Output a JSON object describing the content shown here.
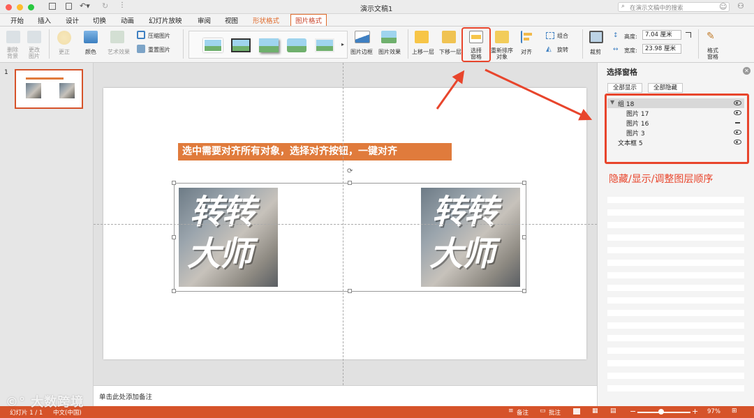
{
  "window": {
    "title": "演示文稿1"
  },
  "search": {
    "placeholder": "在演示文稿中的搜索"
  },
  "ribbon_tabs": [
    "开始",
    "插入",
    "设计",
    "切换",
    "动画",
    "幻灯片放映",
    "审阅",
    "视图",
    "形状格式",
    "图片格式"
  ],
  "ribbon": {
    "remove_bg": "删除\n背景",
    "change_pic": "更改\n图片",
    "corrections": "更正",
    "color": "颜色",
    "artistic": "艺术效果",
    "compress": "压缩图片",
    "reset": "重置图片",
    "pic_border": "图片边框",
    "pic_effects": "图片效果",
    "bring_forward": "上移一层",
    "send_backward": "下移一层",
    "selection_pane": "选择\n窗格",
    "reorder": "重新排序\n对象",
    "align": "对齐",
    "group": "组合",
    "rotate": "旋转",
    "crop": "裁剪",
    "height_label": "高度:",
    "height_value": "7.04 厘米",
    "width_label": "宽度:",
    "width_value": "23.98 厘米",
    "format_pane": "格式\n窗格"
  },
  "thumbnail": {
    "number": "1"
  },
  "slide": {
    "banner": "选中需要对齐所有对象，选择对齐按钮，一键对齐",
    "image_text_line1": "转转",
    "image_text_line2": "大师"
  },
  "notes": {
    "placeholder": "单击此处添加备注"
  },
  "selection_pane": {
    "title": "选择窗格",
    "show_all": "全部显示",
    "hide_all": "全部隐藏",
    "items": [
      {
        "label": "组 18",
        "visible": true
      },
      {
        "label": "图片 17",
        "visible": true
      },
      {
        "label": "图片 16",
        "visible": false
      },
      {
        "label": "图片 3",
        "visible": true
      },
      {
        "label": "文本框 5",
        "visible": true
      }
    ]
  },
  "annotation": {
    "text": "隐藏/显示/调整图层顺序"
  },
  "watermark": {
    "text": "大数跨境"
  },
  "status": {
    "slide_info": "幻灯片 1 / 1",
    "language": "中文(中国)",
    "notes": "备注",
    "comments": "批注",
    "zoom": "97%"
  },
  "colors": {
    "accent": "#d6532a",
    "highlight": "#e8452c",
    "banner_bg": "#e07b3c"
  }
}
